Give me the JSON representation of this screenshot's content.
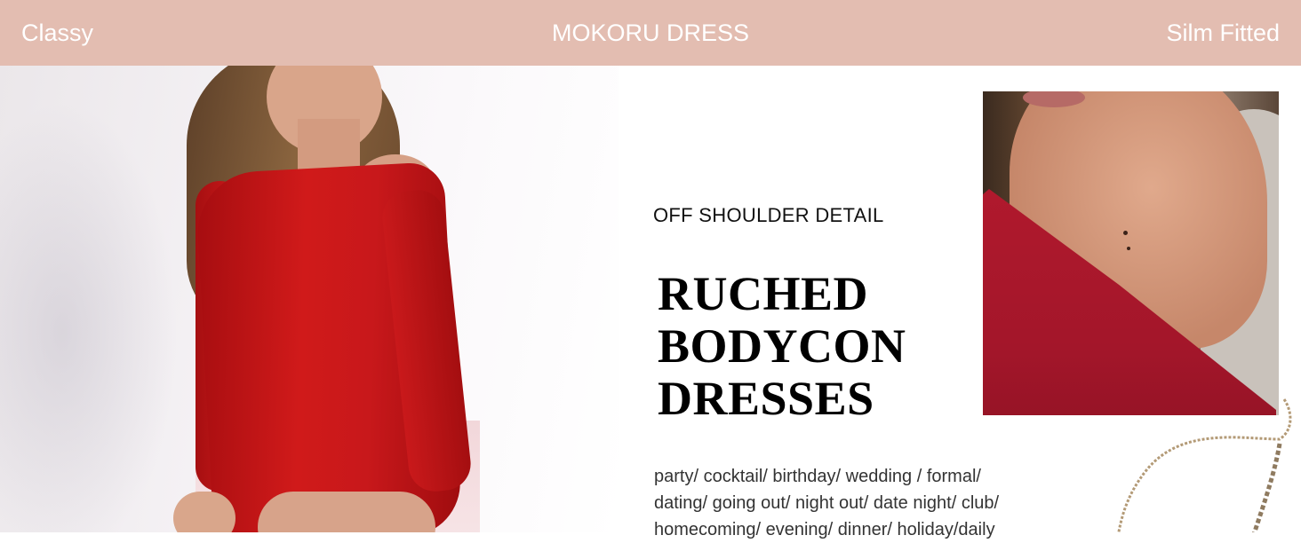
{
  "header": {
    "left": "Classy",
    "center": "MOKORU DRESS",
    "right": "Silm Fitted"
  },
  "feature": {
    "subtitle": "OFF SHOULDER DETAIL",
    "headline_lines": [
      "RUCHED",
      "BODYCON",
      "DRESSES"
    ],
    "occasion_lines": [
      "party/ cocktail/ birthday/ wedding / formal/",
      "dating/ going out/ night out/ date night/ club/",
      "homecoming/ evening/ dinner/ holiday/daily"
    ]
  },
  "colors": {
    "header_bg": "#e3bdb1",
    "header_text": "#ffffff",
    "dress_red": "#c8181b"
  }
}
